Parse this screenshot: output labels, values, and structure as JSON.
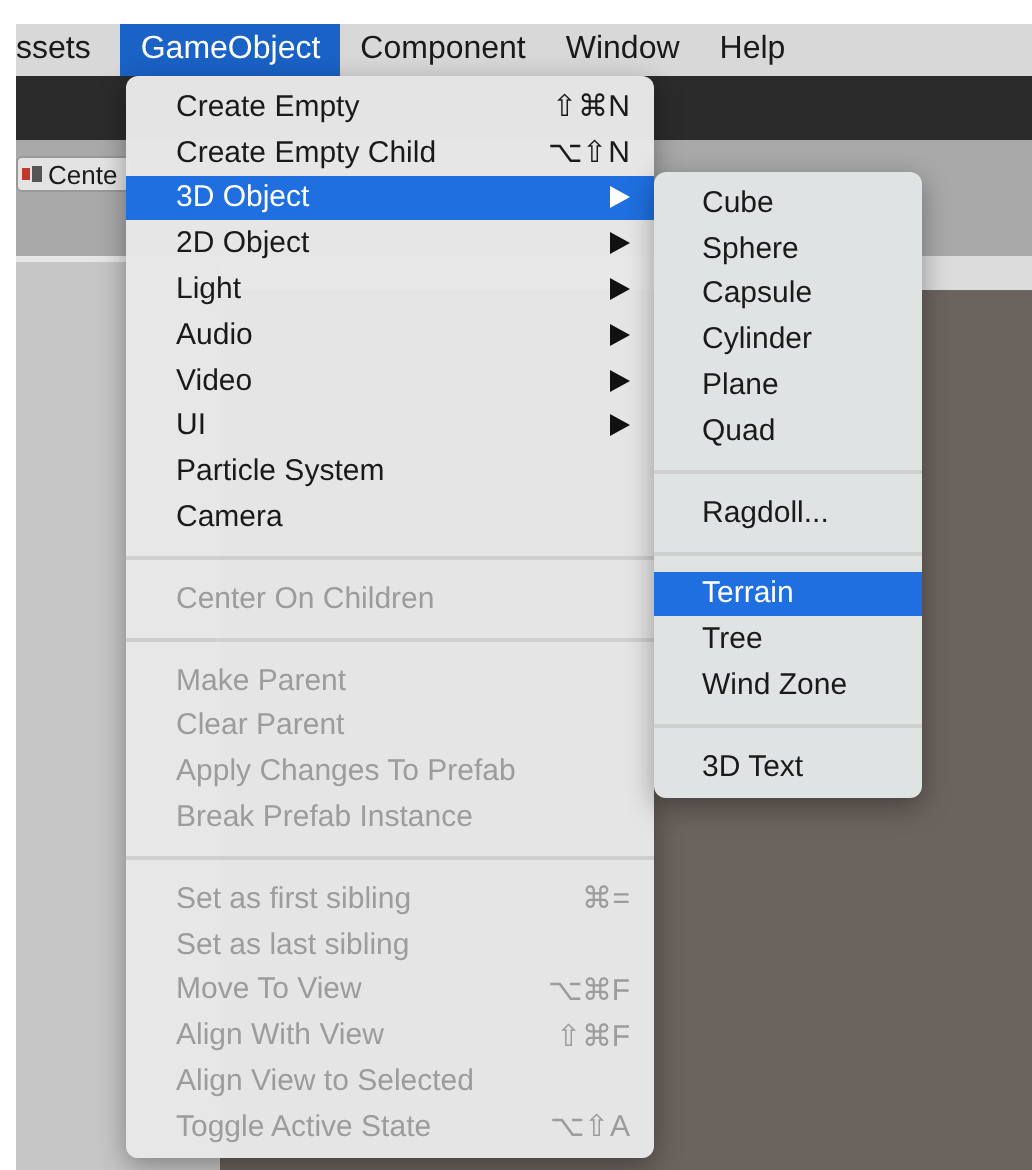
{
  "menubar": [
    {
      "label": "ssets",
      "selected": false
    },
    {
      "label": "GameObject",
      "selected": true
    },
    {
      "label": "Component",
      "selected": false
    },
    {
      "label": "Window",
      "selected": false
    },
    {
      "label": "Help",
      "selected": false
    }
  ],
  "toolbar": {
    "pivot_button": "Cente"
  },
  "menu": [
    {
      "kind": "item",
      "label": "Create Empty",
      "shortcut": "⇧⌘N",
      "disabled": false,
      "selected": false,
      "submenu": false
    },
    {
      "kind": "item",
      "label": "Create Empty Child",
      "shortcut": "⌥⇧N",
      "disabled": false,
      "selected": false,
      "submenu": false
    },
    {
      "kind": "item",
      "label": "3D Object",
      "disabled": false,
      "selected": true,
      "submenu": true
    },
    {
      "kind": "item",
      "label": "2D Object",
      "disabled": false,
      "selected": false,
      "submenu": true
    },
    {
      "kind": "item",
      "label": "Light",
      "disabled": false,
      "selected": false,
      "submenu": true
    },
    {
      "kind": "item",
      "label": "Audio",
      "disabled": false,
      "selected": false,
      "submenu": true
    },
    {
      "kind": "item",
      "label": "Video",
      "disabled": false,
      "selected": false,
      "submenu": true
    },
    {
      "kind": "item",
      "label": "UI",
      "disabled": false,
      "selected": false,
      "submenu": true
    },
    {
      "kind": "item",
      "label": "Particle System",
      "disabled": false,
      "selected": false,
      "submenu": false
    },
    {
      "kind": "item",
      "label": "Camera",
      "disabled": false,
      "selected": false,
      "submenu": false
    },
    {
      "kind": "separator"
    },
    {
      "kind": "item",
      "label": "Center On Children",
      "disabled": true,
      "selected": false,
      "submenu": false
    },
    {
      "kind": "separator"
    },
    {
      "kind": "item",
      "label": "Make Parent",
      "disabled": true,
      "selected": false,
      "submenu": false
    },
    {
      "kind": "item",
      "label": "Clear Parent",
      "disabled": true,
      "selected": false,
      "submenu": false
    },
    {
      "kind": "item",
      "label": "Apply Changes To Prefab",
      "disabled": true,
      "selected": false,
      "submenu": false
    },
    {
      "kind": "item",
      "label": "Break Prefab Instance",
      "disabled": true,
      "selected": false,
      "submenu": false
    },
    {
      "kind": "separator"
    },
    {
      "kind": "item",
      "label": "Set as first sibling",
      "shortcut": "⌘=",
      "disabled": true,
      "selected": false,
      "submenu": false
    },
    {
      "kind": "item",
      "label": "Set as last sibling",
      "disabled": true,
      "selected": false,
      "submenu": false
    },
    {
      "kind": "item",
      "label": "Move To View",
      "shortcut": "⌥⌘F",
      "disabled": true,
      "selected": false,
      "submenu": false
    },
    {
      "kind": "item",
      "label": "Align With View",
      "shortcut": "⇧⌘F",
      "disabled": true,
      "selected": false,
      "submenu": false
    },
    {
      "kind": "item",
      "label": "Align View to Selected",
      "disabled": true,
      "selected": false,
      "submenu": false
    },
    {
      "kind": "item",
      "label": "Toggle Active State",
      "shortcut": "⌥⇧A",
      "disabled": true,
      "selected": false,
      "submenu": false
    }
  ],
  "submenu": [
    {
      "kind": "item",
      "label": "Cube",
      "selected": false
    },
    {
      "kind": "item",
      "label": "Sphere",
      "selected": false
    },
    {
      "kind": "item",
      "label": "Capsule",
      "selected": false
    },
    {
      "kind": "item",
      "label": "Cylinder",
      "selected": false
    },
    {
      "kind": "item",
      "label": "Plane",
      "selected": false
    },
    {
      "kind": "item",
      "label": "Quad",
      "selected": false
    },
    {
      "kind": "separator"
    },
    {
      "kind": "item",
      "label": "Ragdoll...",
      "selected": false
    },
    {
      "kind": "separator"
    },
    {
      "kind": "item",
      "label": "Terrain",
      "selected": true
    },
    {
      "kind": "item",
      "label": "Tree",
      "selected": false
    },
    {
      "kind": "item",
      "label": "Wind Zone",
      "selected": false
    },
    {
      "kind": "separator"
    },
    {
      "kind": "item",
      "label": "3D Text",
      "selected": false
    }
  ]
}
